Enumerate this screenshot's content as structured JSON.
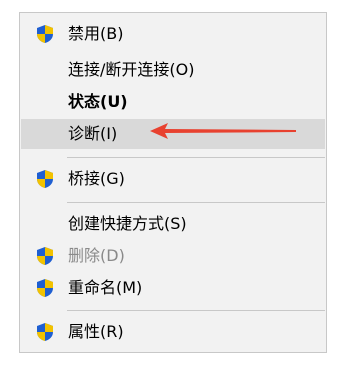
{
  "menu": {
    "items": [
      {
        "label": "禁用(B)",
        "icon": "uac-shield-icon"
      },
      {
        "label": "连接/断开连接(O)"
      },
      {
        "label": "状态(U)"
      },
      {
        "label": "诊断(I)"
      },
      {
        "label": "桥接(G)",
        "icon": "uac-shield-icon"
      },
      {
        "label": "创建快捷方式(S)"
      },
      {
        "label": "删除(D)",
        "icon": "uac-shield-icon",
        "state": "disabled"
      },
      {
        "label": "重命名(M)",
        "icon": "uac-shield-icon"
      },
      {
        "label": "属性(R)",
        "icon": "uac-shield-icon"
      }
    ]
  },
  "annotation": {
    "color": "#e8412f",
    "icon": "red-arrow-icon"
  }
}
